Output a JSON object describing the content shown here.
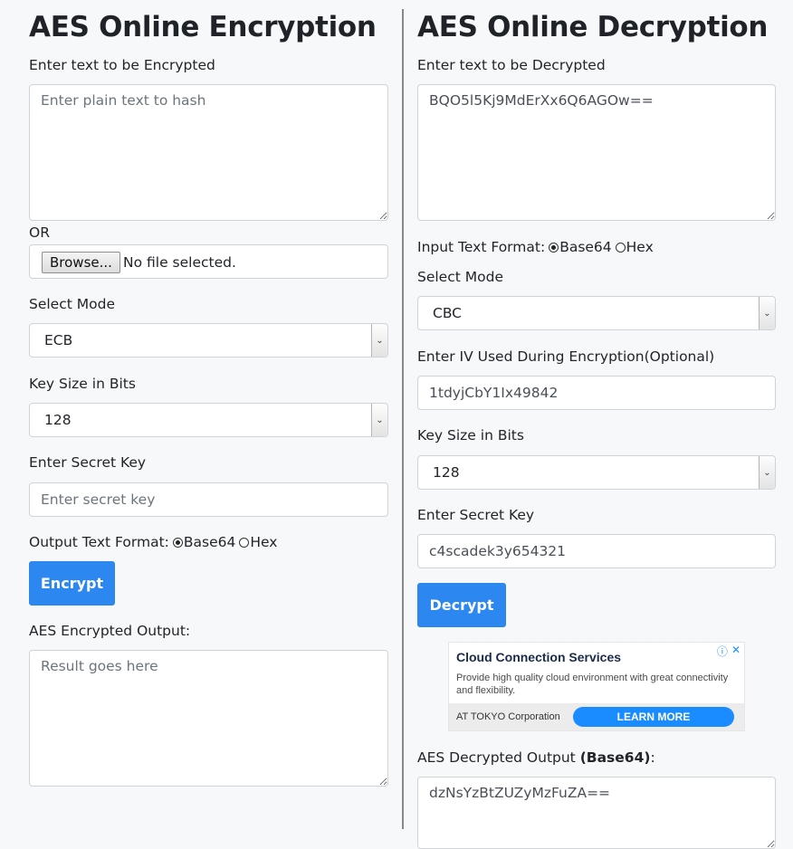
{
  "encryption": {
    "title": "AES Online Encryption",
    "input_label": "Enter text to be Encrypted",
    "input_placeholder": "Enter plain text to hash",
    "or_label": "OR",
    "browse_label": "Browse...",
    "file_status": "No file selected.",
    "mode_label": "Select Mode",
    "mode_value": "ECB",
    "keysize_label": "Key Size in Bits",
    "keysize_value": "128",
    "secret_label": "Enter Secret Key",
    "secret_placeholder": "Enter secret key",
    "output_format_label": "Output Text Format:",
    "format_options": [
      "Base64",
      "Hex"
    ],
    "format_selected": "Base64",
    "encrypt_button": "Encrypt",
    "output_label": "AES Encrypted Output:",
    "output_placeholder": "Result goes here"
  },
  "decryption": {
    "title": "AES Online Decryption",
    "input_label": "Enter text to be Decrypted",
    "input_value": "BQO5l5Kj9MdErXx6Q6AGOw==",
    "input_format_label": "Input Text Format:",
    "format_options": [
      "Base64",
      "Hex"
    ],
    "format_selected": "Base64",
    "mode_label": "Select Mode",
    "mode_value": "CBC",
    "iv_label": "Enter IV Used During Encryption(Optional)",
    "iv_value": "1tdyjCbY1Ix49842",
    "keysize_label": "Key Size in Bits",
    "keysize_value": "128",
    "secret_label": "Enter Secret Key",
    "secret_value": "c4scadek3y654321",
    "decrypt_button": "Decrypt",
    "output_label_prefix": "AES Decrypted Output ",
    "output_label_format": "(Base64)",
    "output_label_suffix": ":",
    "output_value": "dzNsYzBtZUZyMzFuZA=="
  },
  "ad": {
    "title": "Cloud Connection Services",
    "description": "Provide high quality cloud environment with great connectivity and flexibility.",
    "company": "AT TOKYO Corporation",
    "cta": "LEARN MORE",
    "info_icon": "info-icon",
    "close_icon": "close-icon"
  }
}
